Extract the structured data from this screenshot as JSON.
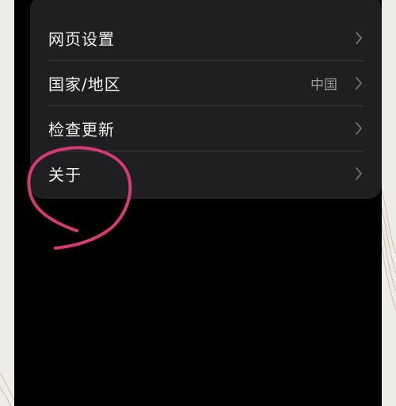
{
  "settings": {
    "rows": [
      {
        "label": "网页设置",
        "value": "",
        "icon": "chevron-right-icon"
      },
      {
        "label": "国家/地区",
        "value": "中国",
        "icon": "chevron-right-icon"
      },
      {
        "label": "检查更新",
        "value": "",
        "icon": "chevron-right-icon"
      },
      {
        "label": "关于",
        "value": "",
        "icon": "chevron-right-icon"
      }
    ]
  },
  "colors": {
    "card_background": "#1f1f21",
    "screen_background": "#000000",
    "annotation_stroke": "#d33a77",
    "text_primary": "#f2f2f2",
    "text_secondary": "#9c9c9e"
  }
}
